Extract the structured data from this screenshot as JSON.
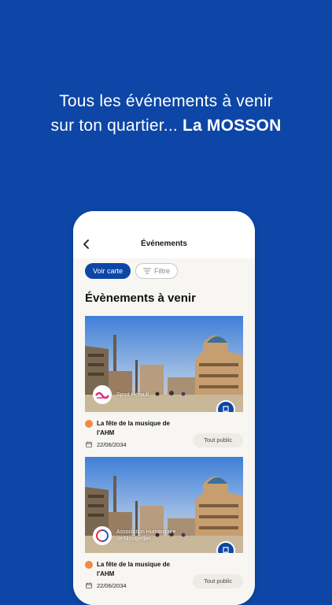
{
  "promo": {
    "line1": "Tous les événements à venir",
    "line2_prefix": "sur ton quartier...",
    "line2_highlight": "La MOSSON"
  },
  "screen": {
    "title": "Événements",
    "chips": {
      "map": "Voir carte",
      "filter": "Filtre"
    },
    "section_title": "Évènements à venir"
  },
  "events": [
    {
      "organizer": "Sport Hérault",
      "title": "La fête de la musique de l'AHM",
      "date": "22/06/2034",
      "audience": "Tout public"
    },
    {
      "organizer": "Association Humanitaire de Montpellier",
      "title": "La fête de la musique de l'AHM",
      "date": "22/06/2034",
      "audience": "Tout public"
    }
  ],
  "colors": {
    "brand_blue": "#0d46a6",
    "accent_orange": "#f08a45",
    "background": "#f7f6f2"
  },
  "icons": [
    "back-icon",
    "filter-icon",
    "bookmark-icon",
    "calendar-icon"
  ]
}
